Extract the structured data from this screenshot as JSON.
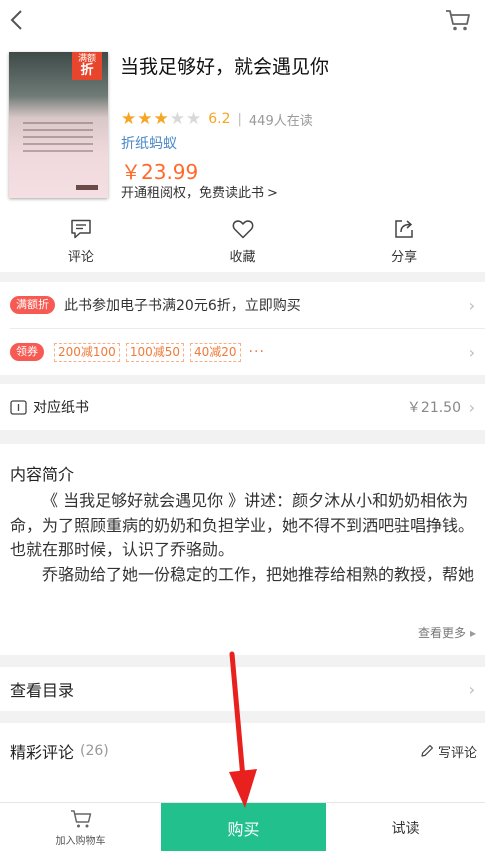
{
  "header": {
    "back_icon": "chevron-left-icon",
    "cart_icon": "cart-icon"
  },
  "book": {
    "title": "当我足够好，就会遇见你",
    "cover_tag_top": "满额",
    "cover_tag_main": "折",
    "rating_stars": 3,
    "rating_max": 5,
    "score": "6.2",
    "separator": "|",
    "readers": "449人在读",
    "author": "折纸蚂蚁",
    "price": "￥23.99",
    "rent_text": "开通租阅权，免费读此书",
    "rent_arrow": ">"
  },
  "actions": [
    {
      "label": "评论",
      "icon": "comment-icon"
    },
    {
      "label": "收藏",
      "icon": "heart-icon"
    },
    {
      "label": "分享",
      "icon": "share-icon"
    }
  ],
  "promo": {
    "badge": "满额折",
    "text": "此书参加电子书满20元6折，立即购买"
  },
  "coupons": {
    "badge": "领券",
    "items": [
      "200减100",
      "100减50",
      "40减20"
    ],
    "more": "···"
  },
  "paper_book": {
    "label": "对应纸书",
    "price": "￥21.50",
    "icon": "book-icon"
  },
  "intro": {
    "title": "内容简介",
    "paragraphs": [
      "《 当我足够好就会遇见你 》讲述：颜夕沐从小和奶奶相依为命，为了照顾重病的奶奶和负担学业，她不得不到洒吧驻唱挣钱。也就在那时候，认识了乔骆勋。",
      "乔骆勋给了她一份稳定的工作，把她推荐给相熟的教授，帮她争取出国的名额，替她奶奶寻找合适的肾源。而这一切颜夕沐却..."
    ],
    "see_more": "查看更多",
    "see_more_arrow": "▸"
  },
  "toc": {
    "label": "查看目录"
  },
  "reviews": {
    "label": "精彩评论",
    "count": "(26)",
    "write": "写评论"
  },
  "chevron": "›",
  "bottom": {
    "add_cart": "加入购物车",
    "buy": "购买",
    "trial": "试读"
  },
  "colors": {
    "accent_green": "#21c08c",
    "price_orange": "#ff6a2b",
    "star": "#f5a623",
    "badge_red": "#f65a52",
    "annotation_red": "#e8201e"
  }
}
